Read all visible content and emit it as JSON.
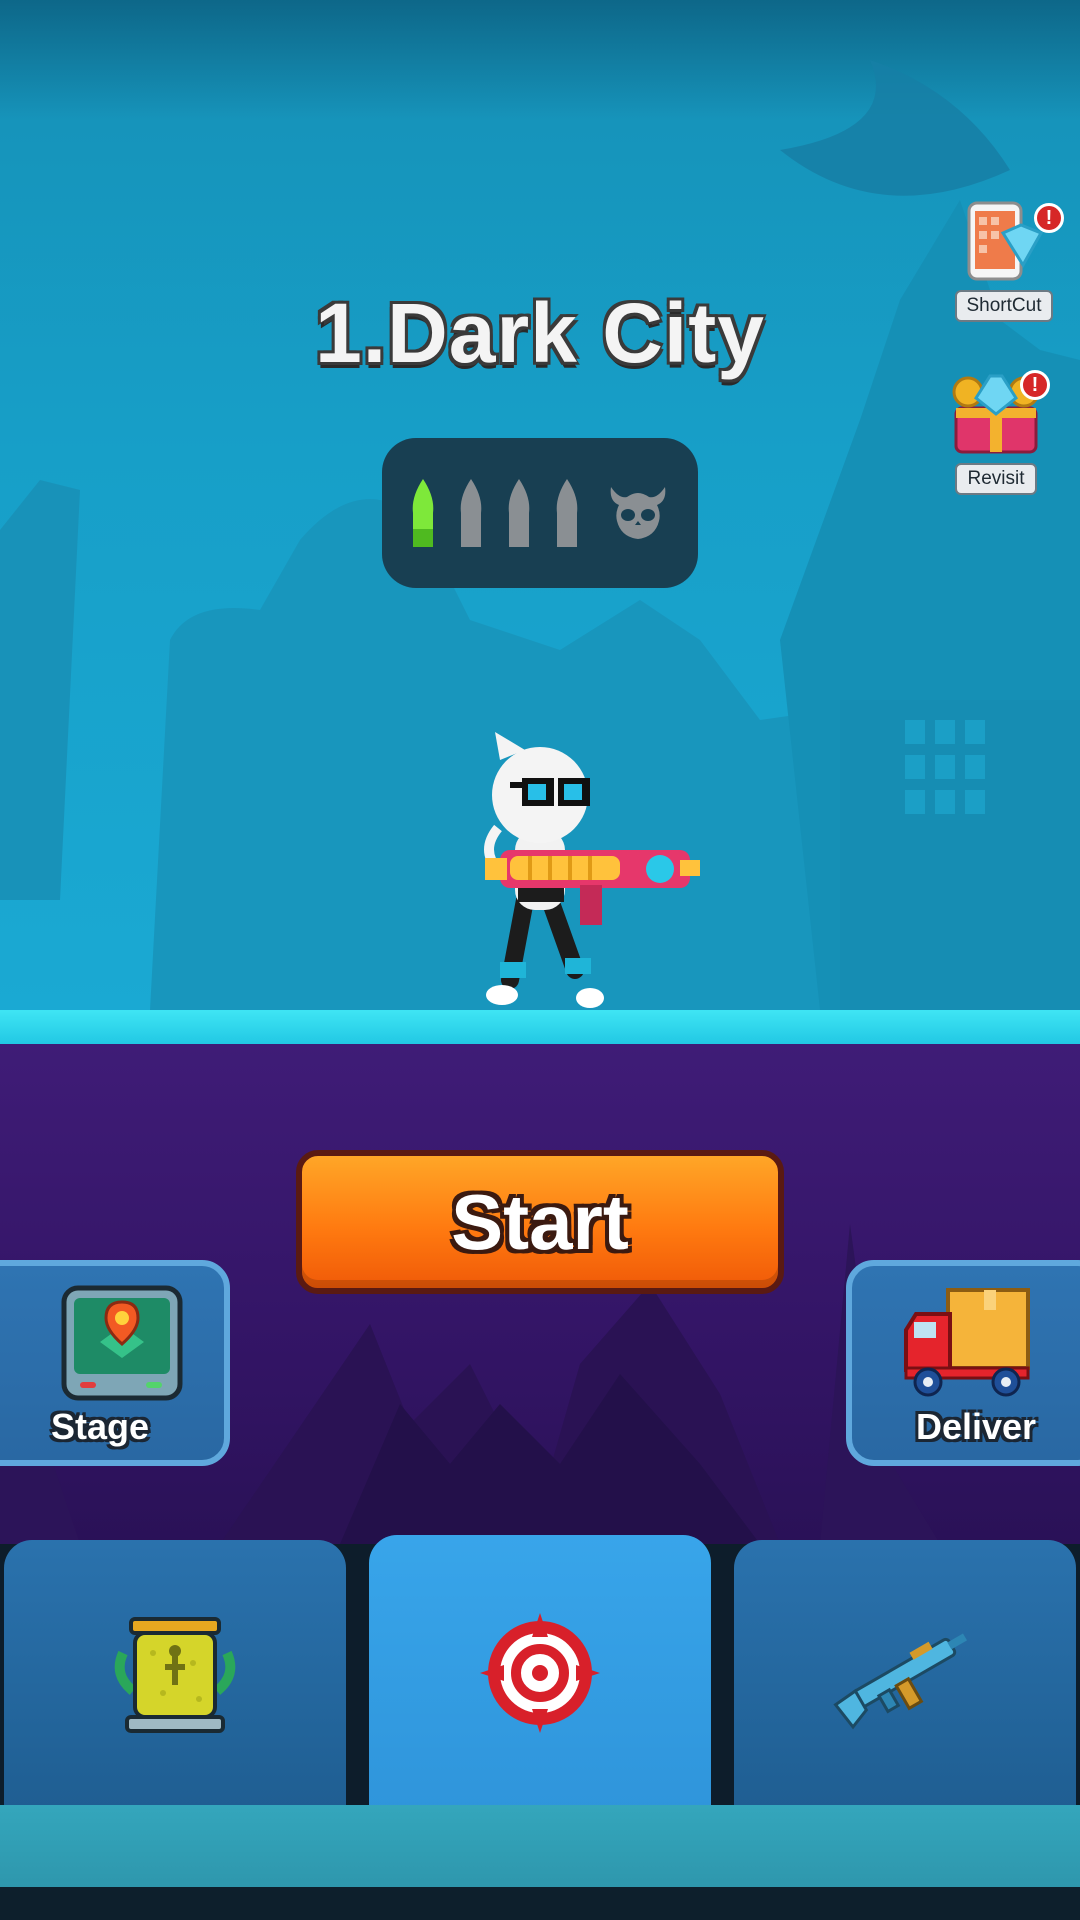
{
  "level": {
    "title": "1.Dark City"
  },
  "progress": {
    "stages_total": 4,
    "stages_completed": 1,
    "boss_icon": "skull-icon",
    "active_color": "#7ee83a",
    "inactive_color": "#8a8f93"
  },
  "side_buttons": {
    "shortcut": {
      "label": "ShortCut",
      "icon": "phone-diamond-icon",
      "alert": "!"
    },
    "revisit": {
      "label": "Revisit",
      "icon": "gem-chest-icon",
      "alert": "!"
    }
  },
  "start": {
    "label": "Start"
  },
  "stage": {
    "label": "Stage",
    "icon": "map-monitor-icon"
  },
  "deliver": {
    "label": "Deliver",
    "icon": "delivery-truck-icon"
  },
  "tabs": [
    {
      "icon": "trophy-cup-icon",
      "active": false
    },
    {
      "icon": "crosshair-target-icon",
      "active": true
    },
    {
      "icon": "assault-rifle-icon",
      "active": false
    }
  ],
  "colors": {
    "sky": "#179fc8",
    "purple": "#3a1870",
    "start_orange": "#ff7a10",
    "tab_active": "#35a1e6",
    "tab_inactive": "#2469a2"
  }
}
